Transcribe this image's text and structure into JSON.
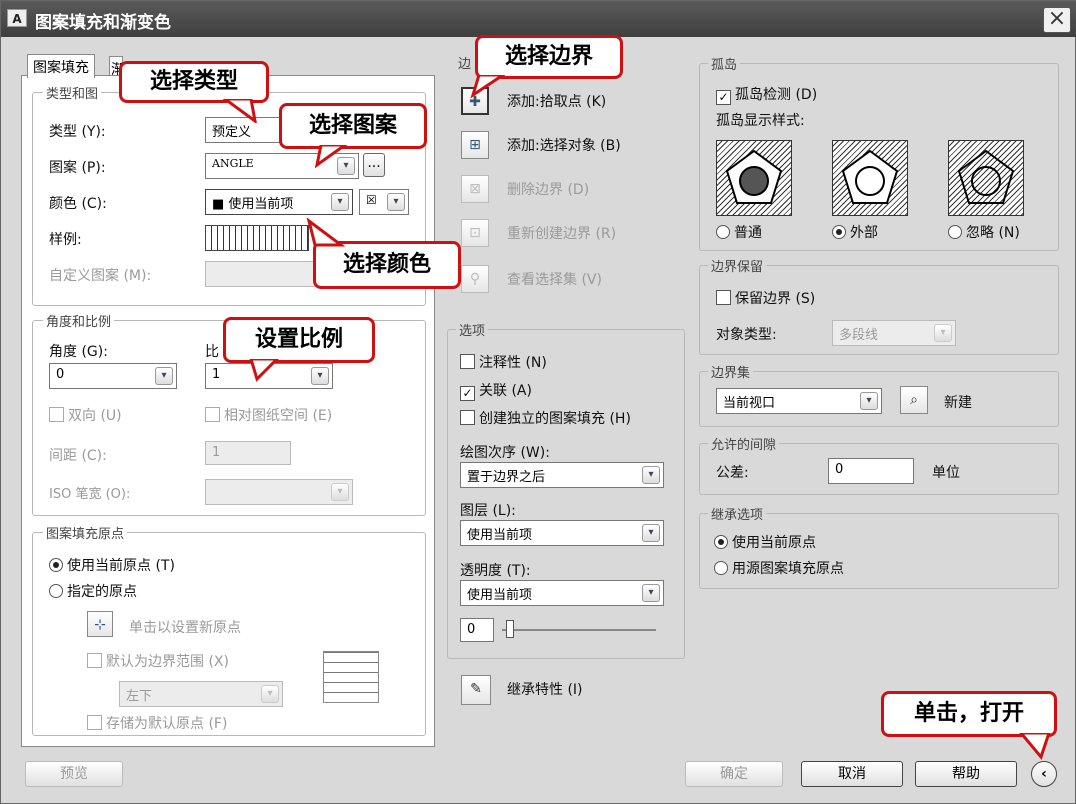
{
  "window": {
    "title": "图案填充和渐变色",
    "app_icon": "A",
    "close": "×"
  },
  "tabs": {
    "hatch": "图案填充",
    "gradient": "渐"
  },
  "type_group": {
    "title": "类型和图",
    "type_label": "类型 (Y):",
    "type_value": "预定义",
    "pattern_label": "图案 (P):",
    "pattern_value": "ANGLE",
    "browse": "...",
    "color_label": "颜色 (C):",
    "color_value": "■ 使用当前项",
    "swatch_label": "样例:",
    "custom_label": "自定义图案 (M):"
  },
  "angle_group": {
    "title": "角度和比例",
    "angle_label": "角度 (G):",
    "angle_value": "0",
    "scale_label": "比",
    "scale_value": "1",
    "double_label": "双向 (U)",
    "relative_label": "相对图纸空间 (E)",
    "spacing_label": "间距 (C):",
    "spacing_value": "1",
    "iso_label": "ISO 笔宽 (O):"
  },
  "origin_group": {
    "title": "图案填充原点",
    "use_current": "使用当前原点 (T)",
    "specified": "指定的原点",
    "click_set": "单击以设置新原点",
    "default_extent": "默认为边界范围 (X)",
    "position_value": "左下",
    "store_default": "存储为默认原点 (F)"
  },
  "boundary": {
    "title": "边",
    "add_pick": "添加:拾取点 (K)",
    "add_select": "添加:选择对象 (B)",
    "remove": "删除边界 (D)",
    "recreate": "重新创建边界 (R)",
    "view": "查看选择集 (V)"
  },
  "options": {
    "title": "选项",
    "annotative": "注释性 (N)",
    "associative": "关联 (A)",
    "separate": "创建独立的图案填充 (H)",
    "draw_order_label": "绘图次序 (W):",
    "draw_order_value": "置于边界之后",
    "layer_label": "图层 (L):",
    "layer_value": "使用当前项",
    "transparency_label": "透明度 (T):",
    "transparency_value": "使用当前项",
    "transparency_num": "0"
  },
  "inherit": {
    "label": "继承特性 (I)"
  },
  "islands": {
    "title": "孤岛",
    "detect": "孤岛检测 (D)",
    "style_label": "孤岛显示样式:",
    "normal": "普通",
    "outer": "外部",
    "ignore": "忽略 (N)"
  },
  "retain": {
    "title": "边界保留",
    "keep": "保留边界 (S)",
    "obj_type_label": "对象类型:",
    "obj_type_value": "多段线"
  },
  "boundary_set": {
    "title": "边界集",
    "value": "当前视口",
    "new_label": "新建"
  },
  "gap": {
    "title": "允许的间隙",
    "tolerance_label": "公差:",
    "tolerance_value": "0",
    "unit": "单位"
  },
  "inherit_opts": {
    "title": "继承选项",
    "use_current": "使用当前原点",
    "use_source": "用源图案填充原点"
  },
  "buttons": {
    "preview": "预览",
    "ok": "确定",
    "cancel": "取消",
    "help": "帮助",
    "more": "‹"
  },
  "callouts": {
    "type": "选择类型",
    "pattern": "选择图案",
    "color": "选择颜色",
    "scale": "设置比例",
    "boundary": "选择边界",
    "open": "单击，打开"
  }
}
